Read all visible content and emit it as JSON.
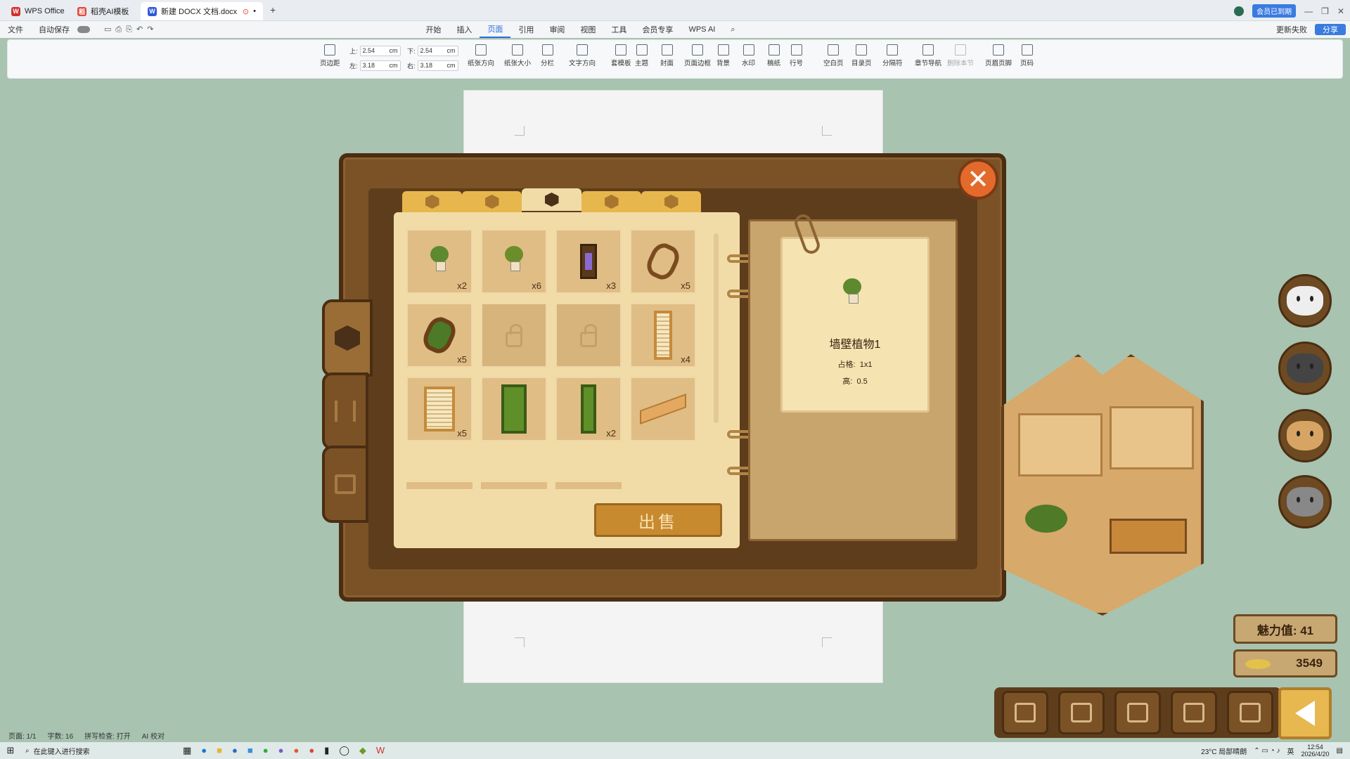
{
  "titlebar": {
    "tabs": [
      {
        "label": "WPS Office",
        "icon": "wps-logo-icon",
        "color": "#d0312d"
      },
      {
        "label": "稻壳AI模板",
        "icon": "docer-icon",
        "color": "#e0483b"
      },
      {
        "label": "新建 DOCX 文档.docx",
        "icon": "word-doc-icon",
        "color": "#2b5bd7"
      }
    ],
    "vip_badge": "会员已到期"
  },
  "menubar": {
    "left": [
      "文件",
      "自动保存"
    ],
    "items": [
      "开始",
      "插入",
      "页面",
      "引用",
      "审阅",
      "视图",
      "工具",
      "会员专享",
      "WPS AI"
    ],
    "active": "页面",
    "right": [
      "更新失败",
      "分享"
    ]
  },
  "ribbon": {
    "margins": {
      "top_label": "上:",
      "top": "2.54",
      "bottom_label": "下:",
      "bottom": "2.54",
      "left_label": "左:",
      "left": "3.18",
      "right_label": "右:",
      "right": "3.18",
      "unit": "cm"
    },
    "buttons_a": [
      "页边距",
      "纸张方向",
      "纸张大小",
      "分栏",
      "文字方向"
    ],
    "buttons_b": [
      "套模板",
      "主题",
      "封面",
      "页面边框",
      "背景",
      "水印",
      "稿纸",
      "行号"
    ],
    "buttons_c": [
      "空白页",
      "目录页",
      "分隔符",
      "章节导航",
      "删除本节"
    ],
    "buttons_d": [
      "页眉页脚",
      "页码"
    ]
  },
  "game": {
    "tabs_count": 5,
    "active_tab_index": 2,
    "grid": [
      {
        "item": "wall-plant",
        "count": "x2"
      },
      {
        "item": "wall-plant-flower",
        "count": "x6"
      },
      {
        "item": "wall-frame",
        "count": "x3"
      },
      {
        "item": "octagon-mirror",
        "count": "x5"
      },
      {
        "item": "wreath",
        "count": "x5"
      },
      {
        "item": "locked",
        "count": ""
      },
      {
        "item": "locked",
        "count": ""
      },
      {
        "item": "window-blind",
        "count": "x4"
      },
      {
        "item": "window-blind",
        "count": "x5"
      },
      {
        "item": "green-door",
        "count": ""
      },
      {
        "item": "green-door-tall",
        "count": "x2"
      },
      {
        "item": "wood-shelf",
        "count": ""
      }
    ],
    "sell_label": "出售",
    "detail": {
      "name": "墙壁植物1",
      "size_label": "占格:",
      "size_value": "1x1",
      "height_label": "高:",
      "height_value": "0.5"
    },
    "charm": "魅力值: 41",
    "fish": "3549"
  },
  "statusbar": {
    "items": [
      "页面: 1/1",
      "字数: 16",
      "拼写检查: 打开",
      "AI 校对"
    ]
  },
  "taskbar": {
    "search_placeholder": "在此键入进行搜索",
    "weather": "23°C 局部晴朗",
    "lang": "英",
    "time": "12:54",
    "date": "2026/4/20"
  }
}
